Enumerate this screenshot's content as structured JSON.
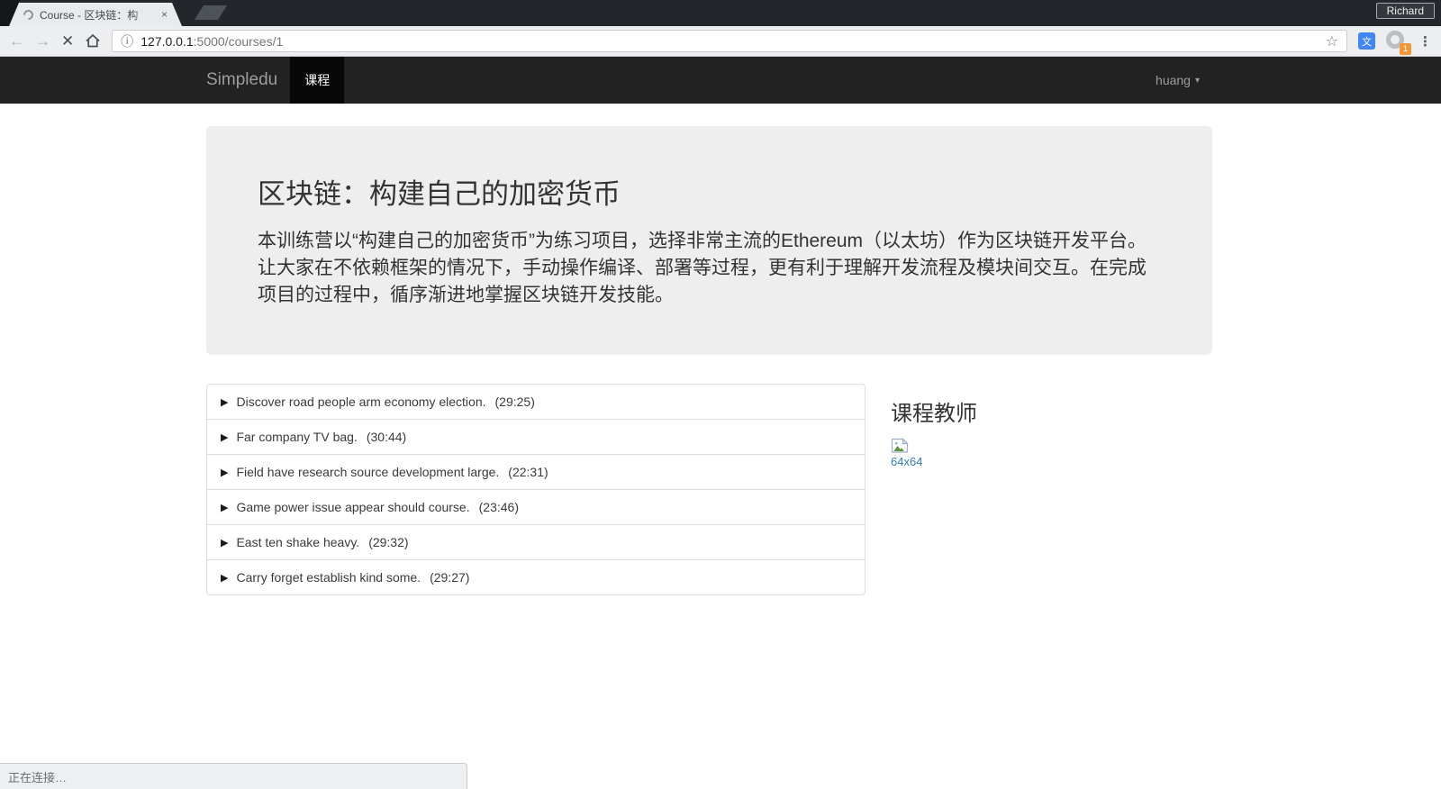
{
  "window": {
    "user_label": "Richard"
  },
  "browser": {
    "tab_title": "Course - 区块链：构",
    "url_host": "127.0.0.1",
    "url_rest": ":5000/courses/1",
    "profile_badge": "1",
    "status_text": "正在连接…"
  },
  "icons": {
    "play": "▶",
    "caret_down": "▾",
    "back": "←",
    "forward": "→",
    "stop": "✕",
    "close": "×",
    "menu": "⋮",
    "star": "☆",
    "info": "ⓘ",
    "translate": "文"
  },
  "navbar": {
    "brand": "Simpledu",
    "active_item": "课程",
    "user_menu": "huang"
  },
  "jumbotron": {
    "title": "区块链：构建自己的加密货币",
    "description": "本训练营以“构建自己的加密货币”为练习项目，选择非常主流的Ethereum（以太坊）作为区块链开发平台。让大家在不依赖框架的情况下，手动操作编译、部署等过程，更有利于理解开发流程及模块间交互。在完成项目的过程中，循序渐进地掌握区块链开发技能。"
  },
  "lessons": [
    {
      "title": "Discover road people arm economy election.",
      "duration": "(29:25)"
    },
    {
      "title": "Far company TV bag.",
      "duration": "(30:44)"
    },
    {
      "title": "Field have research source development large.",
      "duration": "(22:31)"
    },
    {
      "title": "Game power issue appear should course.",
      "duration": "(23:46)"
    },
    {
      "title": "East ten shake heavy.",
      "duration": "(29:32)"
    },
    {
      "title": "Carry forget establish kind some.",
      "duration": "(29:27)"
    }
  ],
  "teacher": {
    "heading": "课程教师",
    "image_alt": "64x64"
  },
  "colors": {
    "navbar_bg": "#222222",
    "navbar_active_bg": "#080808",
    "jumbotron_bg": "#eeeeee",
    "link": "#337ab7",
    "badge_orange": "#f0973a",
    "translate_blue": "#4285f4"
  }
}
